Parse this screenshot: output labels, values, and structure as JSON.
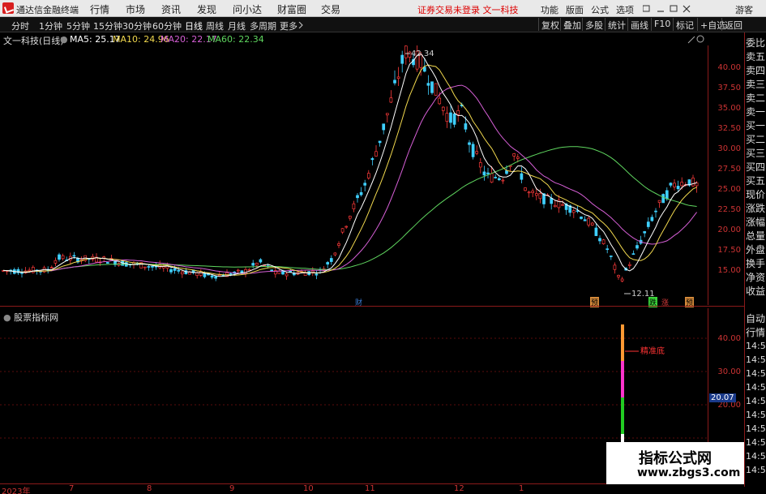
{
  "menubar": {
    "app_title": "通达信金融终端",
    "menus": [
      "行情",
      "市场",
      "资讯",
      "发现",
      "问小达",
      "财富圈",
      "交易"
    ],
    "notice": "证券交易未登录  文一科技",
    "right_menus": [
      "功能",
      "版面",
      "公式",
      "选项"
    ],
    "guest": "游客"
  },
  "toolbar": {
    "periods": [
      "分时",
      "1分钟",
      "5分钟",
      "15分钟",
      "30分钟",
      "60分钟",
      "日线",
      "周线",
      "月线",
      "多周期",
      "更多"
    ],
    "active_period": "日线",
    "right_buttons": [
      "复权",
      "叠加",
      "多股",
      "统计",
      "画线",
      "F10",
      "标记",
      "+自选",
      "返回"
    ]
  },
  "info": {
    "stock": "文一科技(日线)",
    "ma5": "MA5: 25.17",
    "ma10": "MA10: 24.96",
    "ma20": "MA20: 22.17",
    "ma60": "MA60: 22.34",
    "colors": {
      "ma5": "#ffffff",
      "ma10": "#f2d94e",
      "ma20": "#d65fd6",
      "ma60": "#5fd65f"
    }
  },
  "price_axis": [
    "40.00",
    "37.50",
    "35.00",
    "32.50",
    "30.00",
    "27.50",
    "25.00",
    "22.50",
    "20.00",
    "17.50",
    "15.00"
  ],
  "annotations": {
    "high": "42.34",
    "low": "12.11"
  },
  "markers": [
    {
      "label": "财",
      "color": "#3a7bd5"
    },
    {
      "label": "预",
      "color": "#d58a3a"
    },
    {
      "label": "跌",
      "color": "#3ad53a"
    },
    {
      "label": "涨",
      "color": "#d53a3a"
    },
    {
      "label": "预",
      "color": "#d58a3a"
    }
  ],
  "sub": {
    "label": "股票指标网",
    "axis": [
      "40.00",
      "30.00",
      "20.00"
    ],
    "current": "20.07",
    "indicator_label": "精准底"
  },
  "side": {
    "items": [
      "委比",
      "卖五",
      "卖四",
      "卖三",
      "卖二",
      "卖一",
      "买一",
      "买二",
      "买三",
      "买四",
      "买五",
      "现价",
      "涨跌",
      "涨幅",
      "总量",
      "外盘",
      "换手",
      "净资",
      "收益"
    ],
    "lower": [
      "自动",
      "行情"
    ],
    "times": [
      "14:50",
      "14:50",
      "14:50",
      "14:50",
      "14:50",
      "14:50",
      "14:50",
      "14:50",
      "14:50",
      "14:50"
    ]
  },
  "date_axis": [
    "2023年",
    "7",
    "8",
    "9",
    "10",
    "11",
    "12",
    "1"
  ],
  "watermark": {
    "cn": "指标公式网",
    "url": "www.zbgs3.com"
  }
}
